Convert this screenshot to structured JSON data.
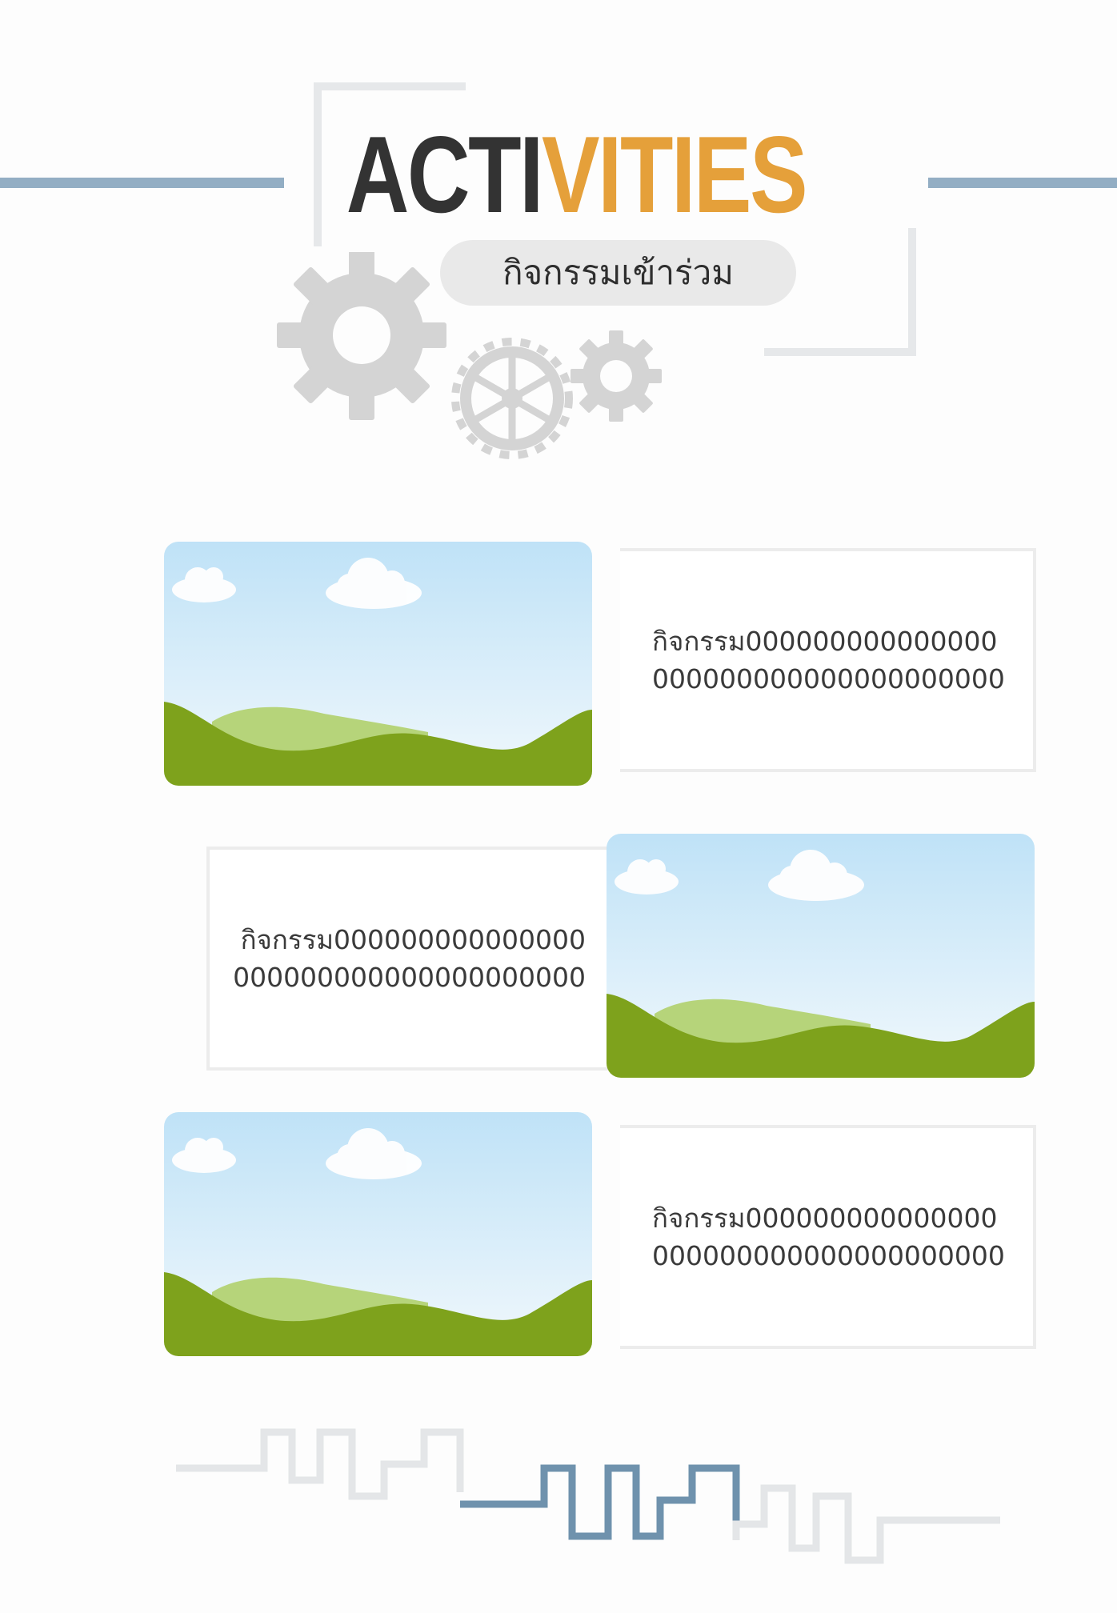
{
  "header": {
    "title_part1": "ACTI",
    "title_part2": "VITIES",
    "subtitle": "กิจกรรมเข้าร่วม"
  },
  "activities": [
    {
      "description": "กิจกรรม000000000000000000000000000000000000"
    },
    {
      "description": "กิจกรรม000000000000000000000000000000000000"
    },
    {
      "description": "กิจกรรม000000000000000000000000000000000000"
    }
  ],
  "colors": {
    "accent": "#e5a03a",
    "title_dark": "#333333",
    "rule_blue": "#93aec4",
    "footer_blue": "#6f92ad",
    "grass": "#7ea21c"
  },
  "icons": [
    "gear-icon",
    "landscape-image-placeholder"
  ]
}
